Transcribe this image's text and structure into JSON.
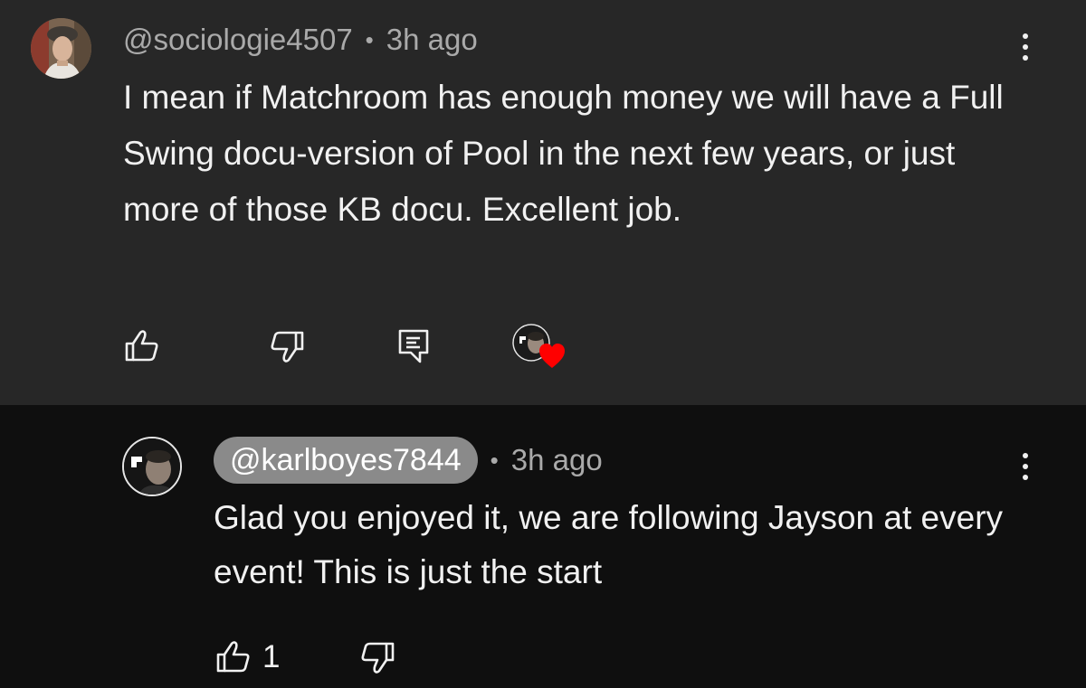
{
  "comment": {
    "author": "@sociologie4507",
    "separator": "•",
    "time": "3h ago",
    "text": "I mean if Matchroom has enough money we will have a Full Swing docu-version of Pool in the next few years, or just more of those KB docu. Excellent job.",
    "actions": {
      "like_icon": "thumbs-up-icon",
      "dislike_icon": "thumbs-down-icon",
      "reply_icon": "reply-icon",
      "creator_heart_icon": "heart-icon"
    }
  },
  "reply": {
    "author": "@karlboyes7844",
    "separator": "•",
    "time": "3h ago",
    "text": "Glad you enjoyed it, we are following Jayson at every event! This is just the start",
    "like_count": "1",
    "actions": {
      "like_icon": "thumbs-up-icon",
      "dislike_icon": "thumbs-down-icon"
    }
  },
  "colors": {
    "highlight_bg": "#272727",
    "page_bg": "#0f0f0f",
    "text": "#f1f1f1",
    "meta_text": "#aaaaaa",
    "creator_chip_bg": "#8a8a8a",
    "heart": "#ff0000"
  }
}
